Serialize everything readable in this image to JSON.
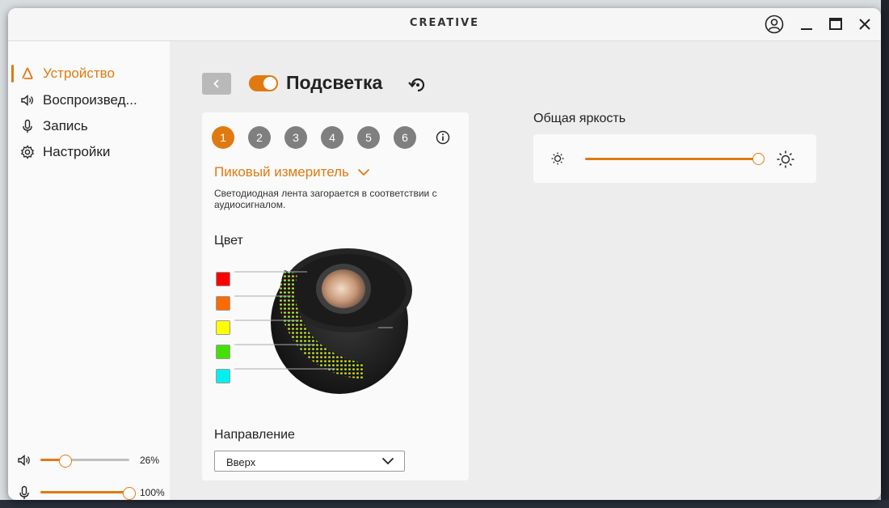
{
  "window": {
    "app_name": "CREATIVE"
  },
  "sidebar": {
    "items": [
      {
        "label": "Устройство",
        "icon": "device-icon",
        "active": true
      },
      {
        "label": "Воспроизвед...",
        "icon": "speaker-icon",
        "active": false
      },
      {
        "label": "Запись",
        "icon": "microphone-icon",
        "active": false
      },
      {
        "label": "Настройки",
        "icon": "gear-icon",
        "active": false
      }
    ],
    "volume": {
      "value": 0.26,
      "label": "26%"
    },
    "mic": {
      "value": 1.0,
      "label": "100%"
    }
  },
  "header": {
    "title": "Подсветка",
    "enabled": true
  },
  "lighting": {
    "steps": [
      "1",
      "2",
      "3",
      "4",
      "5",
      "6"
    ],
    "active_step": 0,
    "mode": "Пиковый измеритель",
    "description": "Светодиодная лента загорается в соответствии с аудиосигналом.",
    "color_label": "Цвет",
    "colors": [
      "#ff0000",
      "#ff6a00",
      "#ffff00",
      "#44e000",
      "#00f0f0"
    ],
    "direction_label": "Направление",
    "direction_value": "Вверх"
  },
  "brightness": {
    "label": "Общая яркость",
    "value": 1.0
  },
  "theme": {
    "accent": "#e07a10"
  }
}
